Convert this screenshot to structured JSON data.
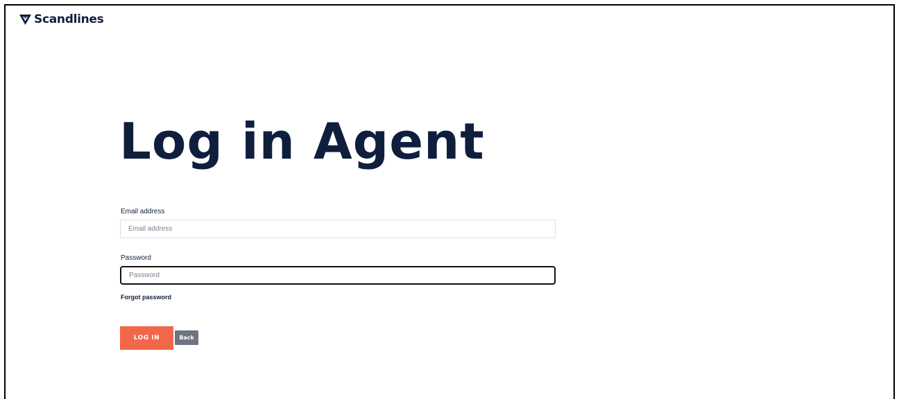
{
  "brand": {
    "name": "Scandlines",
    "logo_icon": "scandlines-chevron-icon",
    "color": "#0f1e3d"
  },
  "page": {
    "title": "Log in Agent"
  },
  "form": {
    "email": {
      "label": "Email address",
      "placeholder": "Email address",
      "value": ""
    },
    "password": {
      "label": "Password",
      "placeholder": "Password",
      "value": "",
      "focused": true
    },
    "forgot_password_label": "Forgot password",
    "login_button_label": "LOG IN",
    "back_button_label": "Back"
  },
  "colors": {
    "primary_text": "#0f1e3d",
    "login_button": "#f1674a",
    "back_button": "#6e7480"
  }
}
